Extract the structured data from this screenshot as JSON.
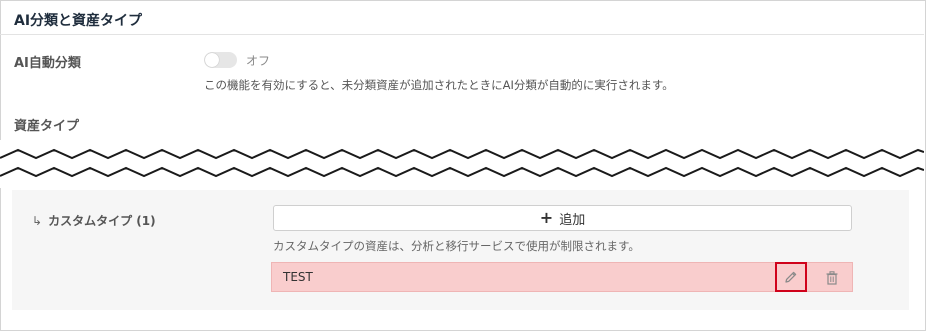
{
  "section": {
    "title": "AI分類と資産タイプ"
  },
  "auto_classification": {
    "label": "AI自動分類",
    "toggle_state": "オフ",
    "toggle_on": false,
    "description": "この機能を有効にすると、未分類資産が追加されたときにAI分類が自動的に実行されます。"
  },
  "asset_types": {
    "label": "資産タイプ"
  },
  "custom_types": {
    "label": "カスタムタイプ (1)",
    "add_label": "追加",
    "note": "カスタムタイプの資産は、分析と移行サービスで使用が制限されます。",
    "items": [
      {
        "name": "TEST"
      }
    ]
  },
  "icons": {
    "arrow": "return-arrow-icon",
    "plus": "plus-icon",
    "edit": "pencil-icon",
    "delete": "trash-icon"
  },
  "colors": {
    "highlight_row": "#f9cdcd",
    "highlight_border": "#d0021b",
    "toggle_off": "#e6e6e6"
  }
}
